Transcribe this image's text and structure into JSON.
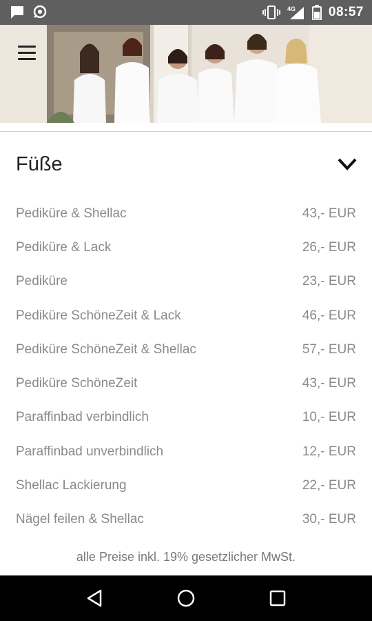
{
  "statusbar": {
    "time": "08:57",
    "network": "4G",
    "icons": [
      "chat-icon",
      "notification-icon",
      "vibrate-icon",
      "signal-icon",
      "battery-icon"
    ]
  },
  "header": {
    "menu_icon": "hamburger-icon",
    "image": "team-photo"
  },
  "section": {
    "title": "Füße",
    "expand_icon": "chevron-down-icon",
    "items": [
      {
        "name": "Pediküre & Shellac",
        "price": "43,- EUR"
      },
      {
        "name": "Pediküre & Lack",
        "price": "26,- EUR"
      },
      {
        "name": "Pediküre",
        "price": "23,- EUR"
      },
      {
        "name": "Pediküre SchöneZeit & Lack",
        "price": "46,- EUR"
      },
      {
        "name": "Pediküre SchöneZeit & Shellac",
        "price": "57,- EUR"
      },
      {
        "name": "Pediküre SchöneZeit",
        "price": "43,- EUR"
      },
      {
        "name": "Paraffinbad verbindlich",
        "price": "10,- EUR"
      },
      {
        "name": "Paraffinbad unverbindlich",
        "price": "12,- EUR"
      },
      {
        "name": "Shellac Lackierung",
        "price": "22,- EUR"
      },
      {
        "name": "Nägel feilen & Shellac",
        "price": "30,- EUR"
      }
    ]
  },
  "footnote": "alle Preise inkl. 19% gesetzlicher MwSt.",
  "navbar": {
    "icons": [
      "back-icon",
      "home-icon",
      "recents-icon"
    ]
  }
}
